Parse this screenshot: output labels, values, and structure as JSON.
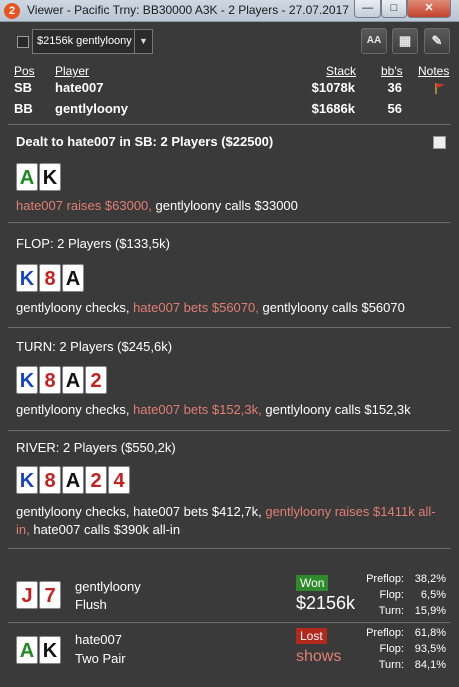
{
  "window": {
    "icon_text": "2",
    "title": "Viewer - Pacific Trny: BB30000 A3K - 2 Players - 27.07.2017 ...",
    "min_label": "—",
    "max_label": "□",
    "close_label": "✕"
  },
  "toolbar": {
    "selected": "$2156k gentlyloony",
    "aa_label": "AA",
    "grid_label": "▦",
    "edit_label": "✎"
  },
  "players": {
    "headers": {
      "pos": "Pos",
      "player": "Player",
      "stack": "Stack",
      "bbs": "bb's",
      "notes": "Notes"
    },
    "rows": [
      {
        "pos": "SB",
        "name": "hate007",
        "stack": "$1078k",
        "bbs": "36"
      },
      {
        "pos": "BB",
        "name": "gentlyloony",
        "stack": "$1686k",
        "bbs": "56"
      }
    ]
  },
  "preflop": {
    "title": "Dealt to hate007 in SB: 2 Players ($22500)",
    "cards": [
      {
        "rank": "A",
        "suit": "c"
      },
      {
        "rank": "K",
        "suit": "s"
      }
    ],
    "action_hl": "hate007 raises $63000,",
    "action_rest": " gentlyloony calls $33000"
  },
  "flop": {
    "title": "FLOP: 2 Players ($133,5k)",
    "cards": [
      {
        "rank": "K",
        "suit": "d"
      },
      {
        "rank": "8",
        "suit": "h"
      },
      {
        "rank": "A",
        "suit": "s"
      }
    ],
    "action_a": "gentlyloony checks, ",
    "action_hl": "hate007 bets $56070,",
    "action_b": " gentlyloony calls $56070"
  },
  "turn": {
    "title": "TURN: 2 Players ($245,6k)",
    "cards": [
      {
        "rank": "K",
        "suit": "d"
      },
      {
        "rank": "8",
        "suit": "h"
      },
      {
        "rank": "A",
        "suit": "s"
      },
      {
        "rank": "2",
        "suit": "h"
      }
    ],
    "action_a": "gentlyloony checks, ",
    "action_hl": "hate007 bets $152,3k,",
    "action_b": " gentlyloony calls $152,3k"
  },
  "river": {
    "title": "RIVER: 2 Players ($550,2k)",
    "cards": [
      {
        "rank": "K",
        "suit": "d"
      },
      {
        "rank": "8",
        "suit": "h"
      },
      {
        "rank": "A",
        "suit": "s"
      },
      {
        "rank": "2",
        "suit": "h"
      },
      {
        "rank": "4",
        "suit": "h"
      }
    ],
    "action_a": "gentlyloony checks, hate007 bets $412,7k, ",
    "action_hl": "gentlyloony raises $1411k all-in,",
    "action_b": " hate007 calls $390k all-in"
  },
  "results": [
    {
      "name": "gentlyloony",
      "hand": "Flush",
      "cards": [
        {
          "rank": "J",
          "suit": "h"
        },
        {
          "rank": "7",
          "suit": "h"
        }
      ],
      "badge": "Won",
      "amount": "$2156k",
      "stats": [
        {
          "label": "Preflop:",
          "value": "38,2%"
        },
        {
          "label": "Flop:",
          "value": "6,5%"
        },
        {
          "label": "Turn:",
          "value": "15,9%"
        }
      ]
    },
    {
      "name": "hate007",
      "hand": "Two Pair",
      "cards": [
        {
          "rank": "A",
          "suit": "c"
        },
        {
          "rank": "K",
          "suit": "s"
        }
      ],
      "badge": "Lost",
      "amount": "shows",
      "stats": [
        {
          "label": "Preflop:",
          "value": "61,8%"
        },
        {
          "label": "Flop:",
          "value": "93,5%"
        },
        {
          "label": "Turn:",
          "value": "84,1%"
        }
      ]
    }
  ],
  "colors": {
    "background": "#3a3a3a",
    "highlight": "#e07f74",
    "won": "#2e8a2b",
    "lost": "#b3291e",
    "club": "#1f8a1f",
    "diamond": "#1a44c6",
    "heart": "#c8201e",
    "spade": "#111111"
  }
}
